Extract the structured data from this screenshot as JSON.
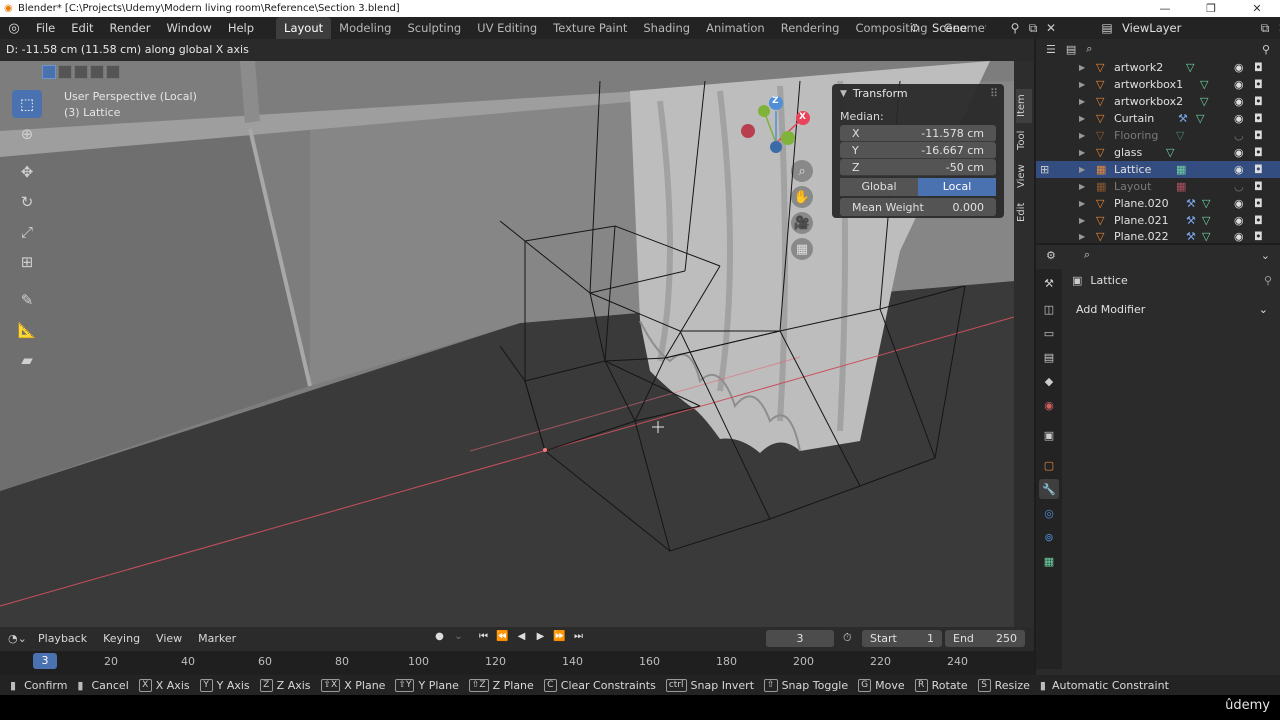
{
  "window": {
    "title": "Blender* [C:\\Projects\\Udemy\\Modern living room\\Reference\\Section 3.blend]",
    "min": "—",
    "max": "❐",
    "close": "✕"
  },
  "menus": [
    "File",
    "Edit",
    "Render",
    "Window",
    "Help"
  ],
  "workspaces": [
    "Layout",
    "Modeling",
    "Sculpting",
    "UV Editing",
    "Texture Paint",
    "Shading",
    "Animation",
    "Rendering",
    "Compositing",
    "Geometr"
  ],
  "active_workspace": "Layout",
  "scene": {
    "name": "Scene"
  },
  "view_layer": {
    "name": "ViewLayer"
  },
  "header_status": "D: -11.58 cm (11.58 cm) along global X axis",
  "viewport": {
    "perspective": "User Perspective (Local)",
    "object": "(3) Lattice"
  },
  "gizmo": {
    "z": "Z",
    "x": "X"
  },
  "transform_panel": {
    "title": "Transform",
    "median_label": "Median:",
    "x_label": "X",
    "x_value": "-11.578 cm",
    "y_label": "Y",
    "y_value": "-16.667 cm",
    "z_label": "Z",
    "z_value": "-50 cm",
    "global_label": "Global",
    "local_label": "Local",
    "mean_weight_label": "Mean Weight",
    "mean_weight_value": "0.000"
  },
  "side_tabs": [
    "Item",
    "Tool",
    "View",
    "Edit"
  ],
  "outliner": {
    "items": [
      {
        "name": "artwork2",
        "dim": false
      },
      {
        "name": "artworkbox1",
        "dim": false
      },
      {
        "name": "artworkbox2",
        "dim": false
      },
      {
        "name": "Curtain",
        "dim": false
      },
      {
        "name": "Flooring",
        "dim": true
      },
      {
        "name": "glass",
        "dim": false
      },
      {
        "name": "Lattice",
        "dim": false,
        "selected": true
      },
      {
        "name": "Layout",
        "dim": true
      },
      {
        "name": "Plane.020",
        "dim": false
      },
      {
        "name": "Plane.021",
        "dim": false
      },
      {
        "name": "Plane.022",
        "dim": false
      }
    ]
  },
  "properties": {
    "object_name": "Lattice",
    "add_modifier": "Add Modifier"
  },
  "timeline": {
    "menus": [
      "Playback",
      "Keying",
      "View",
      "Marker"
    ],
    "current_frame": "3",
    "start_label": "Start",
    "start_value": "1",
    "end_label": "End",
    "end_value": "250",
    "ruler_current": "3",
    "ticks": [
      "20",
      "40",
      "60",
      "80",
      "100",
      "120",
      "140",
      "160",
      "180",
      "200",
      "220",
      "240"
    ]
  },
  "statusbar": [
    {
      "key": "",
      "label": "Confirm"
    },
    {
      "key": "",
      "label": "Cancel"
    },
    {
      "key": "X",
      "label": "X Axis"
    },
    {
      "key": "Y",
      "label": "Y Axis"
    },
    {
      "key": "Z",
      "label": "Z Axis"
    },
    {
      "key": "⇧X",
      "label": "X Plane"
    },
    {
      "key": "⇧Y",
      "label": "Y Plane"
    },
    {
      "key": "⇧Z",
      "label": "Z Plane"
    },
    {
      "key": "C",
      "label": "Clear Constraints"
    },
    {
      "key": "ctrl",
      "label": "Snap Invert"
    },
    {
      "key": "⇧",
      "label": "Snap Toggle"
    },
    {
      "key": "G",
      "label": "Move"
    },
    {
      "key": "R",
      "label": "Rotate"
    },
    {
      "key": "S",
      "label": "Resize"
    },
    {
      "key": "",
      "label": "Automatic Constraint"
    }
  ],
  "watermark": "ûdemy",
  "colors": {
    "accent": "#4a72b0",
    "object_orange": "#e8883a",
    "axis_red": "#e8435a",
    "axis_green": "#7fb339",
    "axis_blue": "#4f8fd8"
  }
}
